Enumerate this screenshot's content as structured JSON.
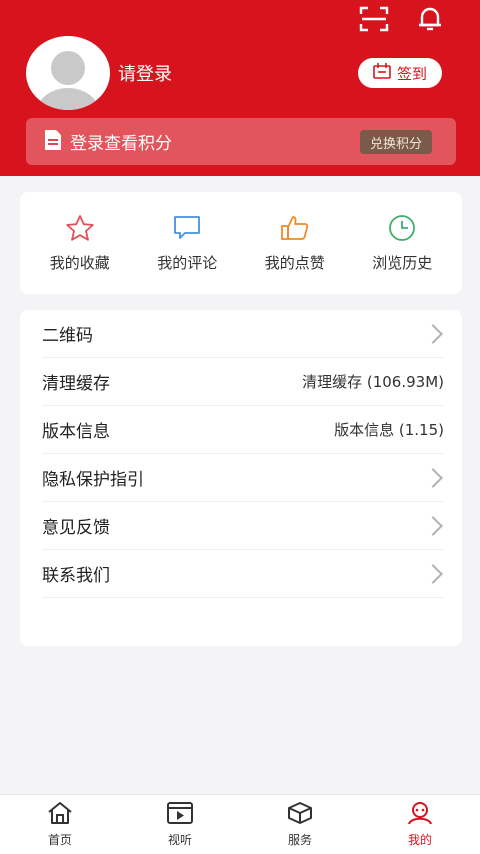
{
  "header": {
    "login_prompt": "请登录",
    "sign_in_label": "签到",
    "points_text": "登录查看积分",
    "exchange_points_label": "兑换积分"
  },
  "quick_actions": [
    {
      "label": "我的收藏",
      "icon": "star-icon",
      "color": "#e0525a"
    },
    {
      "label": "我的评论",
      "icon": "comment-icon",
      "color": "#4a8fe0"
    },
    {
      "label": "我的点赞",
      "icon": "thumbs-up-icon",
      "color": "#f08a28"
    },
    {
      "label": "浏览历史",
      "icon": "clock-icon",
      "color": "#3bb06a"
    }
  ],
  "menu": [
    {
      "label": "二维码",
      "value": ""
    },
    {
      "label": "清理缓存",
      "value": "清理缓存 (106.93M)"
    },
    {
      "label": "版本信息",
      "value": "版本信息 (1.15)"
    },
    {
      "label": "隐私保护指引",
      "value": ""
    },
    {
      "label": "意见反馈",
      "value": ""
    },
    {
      "label": "联系我们",
      "value": ""
    }
  ],
  "tabs": [
    {
      "label": "首页",
      "icon": "home-icon"
    },
    {
      "label": "视听",
      "icon": "video-icon"
    },
    {
      "label": "服务",
      "icon": "box-icon"
    },
    {
      "label": "我的",
      "icon": "profile-icon",
      "active": true
    }
  ],
  "colors": {
    "brand": "#d7141e"
  }
}
